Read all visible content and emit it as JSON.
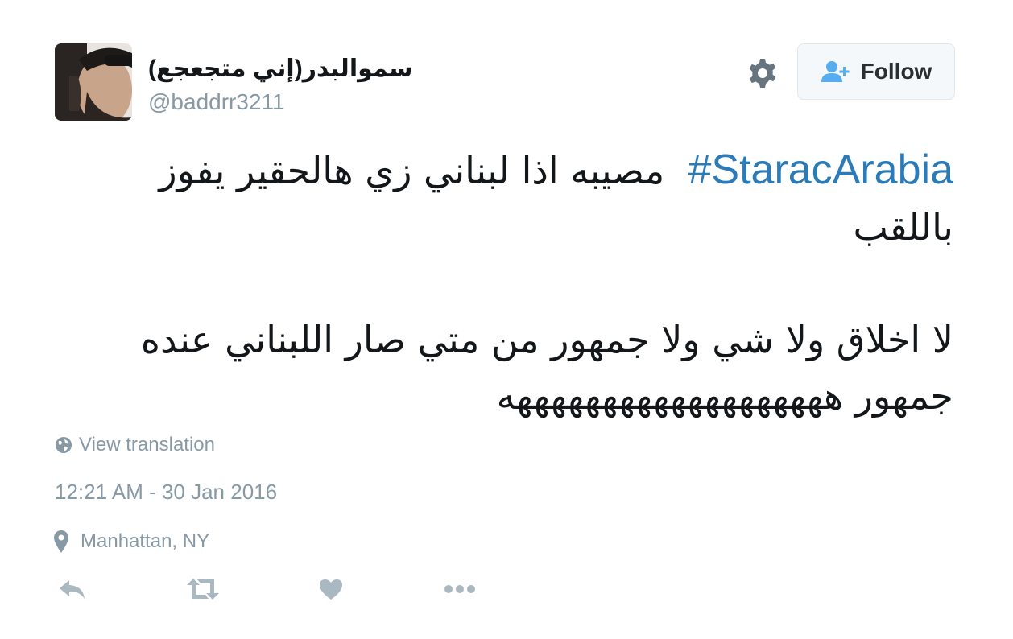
{
  "user": {
    "display_name": "سموالبدر(إني متجعجع)",
    "handle": "@baddrr3211"
  },
  "follow_button": {
    "label": "Follow"
  },
  "tweet": {
    "hashtag": "#StaracArabia",
    "line1_text": "مصيبه اذا لبناني  زي هالحقير يفوز باللقب",
    "line2_text": "لا اخلاق ولا شي   ولا جمهور  من متي صار اللبناني عنده جمهور هههههههههههههههههههه"
  },
  "translation": {
    "label": "View translation"
  },
  "timestamp": "12:21 AM - 30 Jan 2016",
  "location": "Manhattan, NY",
  "icons": {
    "settings": "gear-icon",
    "follow": "follow-user-icon",
    "translation": "globe-icon",
    "location": "location-pin-icon",
    "reply": "reply-icon",
    "retweet": "retweet-icon",
    "like": "heart-icon",
    "more": "more-dots-icon"
  },
  "colors": {
    "hashtag": "#2b7bb9",
    "muted": "#8899a6",
    "action_icons": "#aab8c2",
    "follow_icon": "#55acee"
  }
}
